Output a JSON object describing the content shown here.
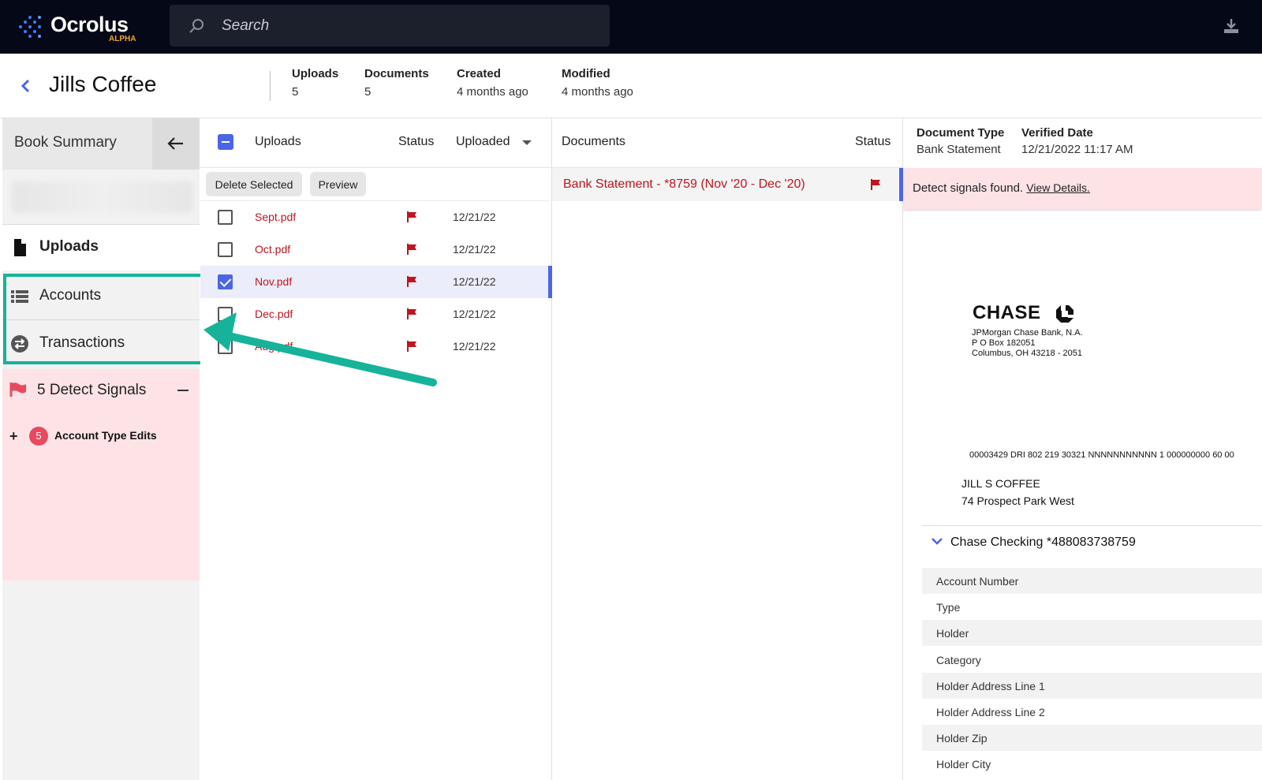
{
  "app": {
    "logo_text": "Ocrolus",
    "logo_badge": "ALPHA"
  },
  "search": {
    "placeholder": "Search"
  },
  "book": {
    "title": "Jills Coffee",
    "meta": [
      {
        "label": "Uploads",
        "value": "5"
      },
      {
        "label": "Documents",
        "value": "5"
      },
      {
        "label": "Created",
        "value": "4 months ago"
      },
      {
        "label": "Modified",
        "value": "4 months ago"
      }
    ]
  },
  "sidebar": {
    "book_summary": "Book Summary",
    "items": [
      {
        "label": "Uploads",
        "icon": "document-icon"
      },
      {
        "label": "Accounts",
        "icon": "list-icon"
      },
      {
        "label": "Transactions",
        "icon": "transfer-icon"
      }
    ],
    "signals": {
      "label": "5 Detect Signals",
      "rows": [
        {
          "count": "5",
          "label": "Account Type Edits"
        }
      ]
    }
  },
  "uploads": {
    "columns": [
      "Uploads",
      "Status",
      "Uploaded"
    ],
    "actions": {
      "delete": "Delete Selected",
      "preview": "Preview"
    },
    "rows": [
      {
        "file": "Sept.pdf",
        "date": "12/21/22",
        "checked": false
      },
      {
        "file": "Oct.pdf",
        "date": "12/21/22",
        "checked": false
      },
      {
        "file": "Nov.pdf",
        "date": "12/21/22",
        "checked": true
      },
      {
        "file": "Dec.pdf",
        "date": "12/21/22",
        "checked": false
      },
      {
        "file": "Aug.pdf",
        "date": "12/21/22",
        "checked": false
      }
    ]
  },
  "documents": {
    "columns": [
      "Documents",
      "Status"
    ],
    "rows": [
      {
        "name": "Bank Statement - *8759 (Nov '20 - Dec '20)"
      }
    ]
  },
  "detail": {
    "doc_type_label": "Document Type",
    "doc_type_value": "Bank Statement",
    "verified_label": "Verified Date",
    "verified_value": "12/21/2022 11:17 AM",
    "alert_text": "Detect signals found.",
    "alert_link": "View Details.",
    "statement": {
      "bank": "CHASE",
      "addr1": "JPMorgan Chase Bank, N.A.",
      "addr2": "P O Box 182051",
      "addr3": "Columbus, OH 43218 - 2051",
      "mailcode": "00003429  DRI 802 219 30321 NNNNNNNNNNN   1 000000000 60  00",
      "customer": "JILL S COFFEE",
      "street": "74 Prospect Park West"
    },
    "account_title": "Chase Checking *488083738759",
    "fields": [
      "Account Number",
      "Type",
      "Holder",
      "Category",
      "Holder Address Line 1",
      "Holder Address Line 2",
      "Holder Zip",
      "Holder City"
    ]
  },
  "colors": {
    "accent": "#4b65e6",
    "flag_red": "#c0141e",
    "highlight_teal": "#16b39a",
    "signal_bg": "#fde3e6"
  }
}
